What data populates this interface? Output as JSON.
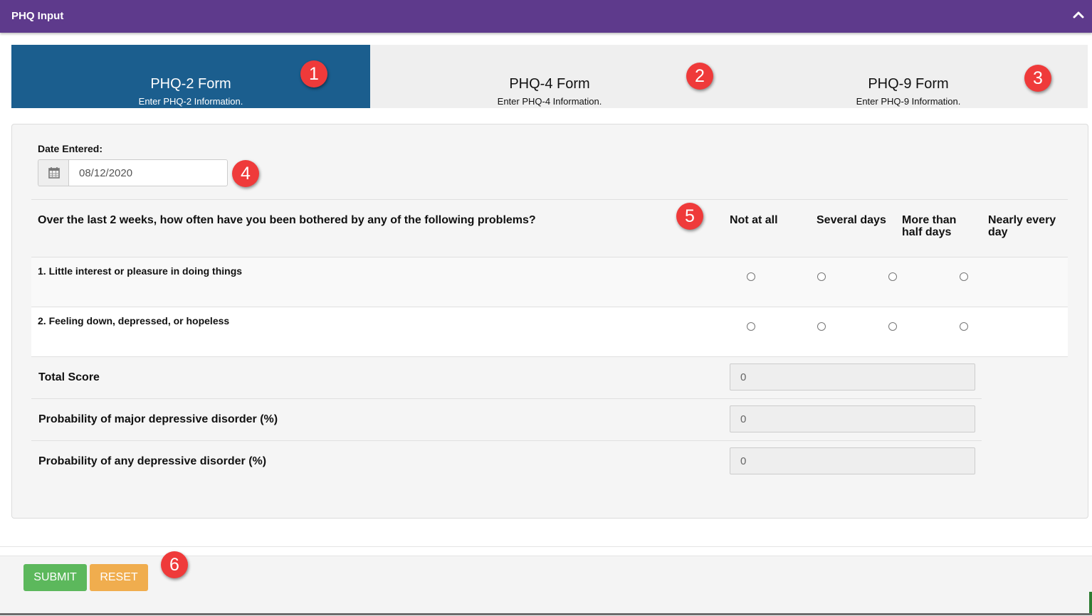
{
  "header": {
    "title": "PHQ Input",
    "collapse_icon": "chevron-up-icon"
  },
  "tabs": [
    {
      "title": "PHQ-2 Form",
      "subtitle": "Enter PHQ-2 Information.",
      "active": true
    },
    {
      "title": "PHQ-4 Form",
      "subtitle": "Enter PHQ-4 Information.",
      "active": false
    },
    {
      "title": "PHQ-9 Form",
      "subtitle": "Enter PHQ-9 Information.",
      "active": false
    }
  ],
  "markers": [
    "1",
    "2",
    "3",
    "4",
    "5",
    "6"
  ],
  "date": {
    "label": "Date Entered:",
    "value": "08/12/2020",
    "icon": "calendar-icon"
  },
  "questionnaire": {
    "prompt": "Over the last 2 weeks, how often have you been bothered by any of the following problems?",
    "options": [
      "Not at all",
      "Several days",
      "More than half days",
      "Nearly every day"
    ],
    "questions": [
      {
        "label": "1. Little interest or pleasure in doing things"
      },
      {
        "label": "2. Feeling down, depressed, or hopeless"
      }
    ]
  },
  "scores": [
    {
      "label": "Total Score",
      "value": "0"
    },
    {
      "label": "Probability of major depressive disorder (%)",
      "value": "0"
    },
    {
      "label": "Probability of any depressive disorder (%)",
      "value": "0"
    }
  ],
  "buttons": {
    "submit": "SUBMIT",
    "reset": "RESET"
  },
  "colors": {
    "header": "#5e3a8c",
    "active_tab": "#1b5e8e",
    "marker": "#ef3a3a",
    "submit": "#5cb85c",
    "reset": "#f0ad4e"
  }
}
